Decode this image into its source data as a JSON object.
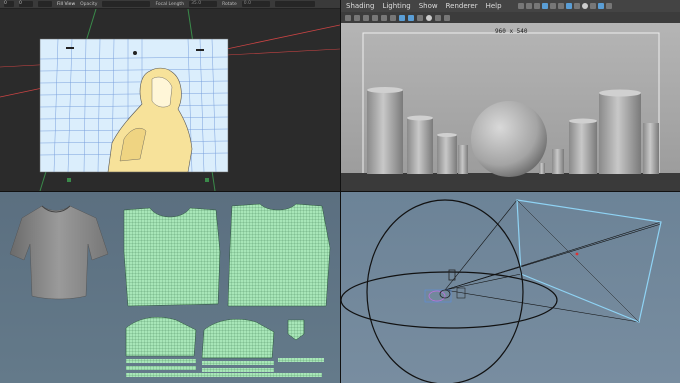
{
  "top_left": {
    "toolbar": {
      "dropdown": "Fill View",
      "opacity_label": "Opacity",
      "focal_length_label": "Focal Length",
      "focal_length_value": "35.0",
      "rotate_label": "Rotate",
      "rotate_value": "0.0",
      "field1": "0",
      "field2": "0"
    }
  },
  "top_right": {
    "menu": [
      "Shading",
      "Lighting",
      "Show",
      "Renderer",
      "Help"
    ],
    "resolution": "960 x 540"
  },
  "colors": {
    "viewport_dark": "#2b2b2b",
    "sketch_yellow": "#f7e29a",
    "sky_blue": "#cfe7fb",
    "uv_green": "#a8e6b8",
    "camera_frustum": "#8fd3f4"
  },
  "icons": {
    "viewport_tools": [
      "select-icon",
      "grid-icon",
      "shading-icon",
      "camera-icon",
      "light-icon",
      "isolate-icon"
    ]
  }
}
